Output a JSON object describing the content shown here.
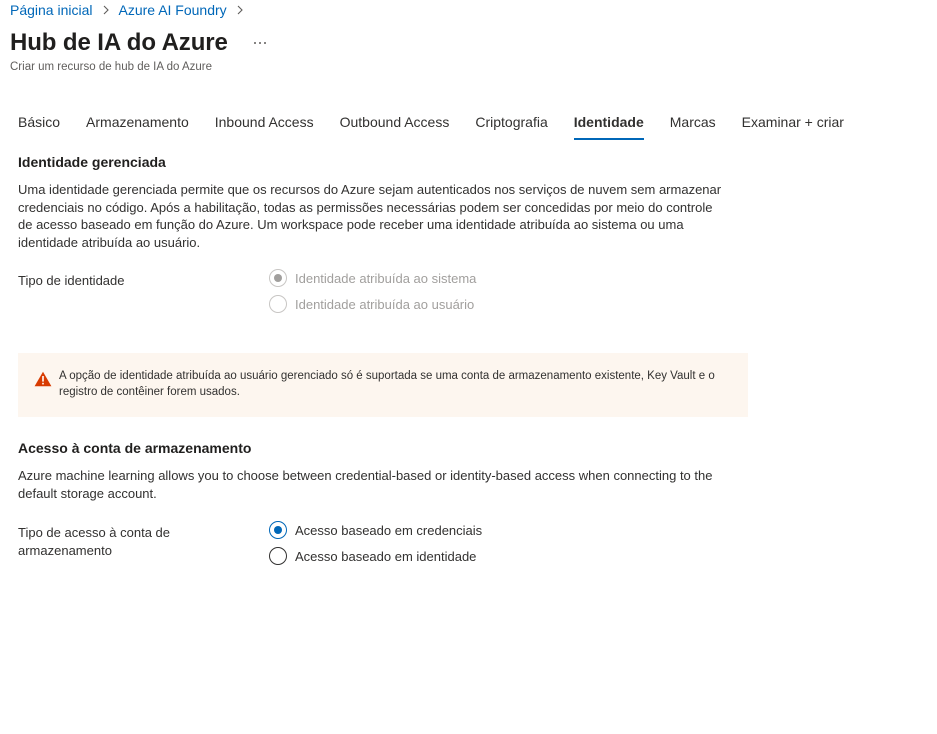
{
  "breadcrumb": {
    "items": [
      "Página inicial",
      "Azure AI Foundry"
    ]
  },
  "header": {
    "title": "Hub de IA do Azure",
    "more_label": "...",
    "subtitle": "Criar um recurso de hub de IA do Azure"
  },
  "tabs": [
    {
      "label": "Básico",
      "active": false
    },
    {
      "label": "Armazenamento",
      "active": false
    },
    {
      "label": "Inbound Access",
      "active": false
    },
    {
      "label": "Outbound Access",
      "active": false
    },
    {
      "label": "Criptografia",
      "active": false
    },
    {
      "label": "Identidade",
      "active": true
    },
    {
      "label": "Marcas",
      "active": false
    },
    {
      "label": "Examinar + criar",
      "active": false
    }
  ],
  "managed_identity": {
    "heading": "Identidade gerenciada",
    "description": "Uma identidade gerenciada permite que os recursos do Azure sejam autenticados nos serviços de nuvem sem armazenar credenciais no código. Após a habilitação, todas as permissões necessárias podem ser concedidas por meio do controle de acesso baseado em função do Azure. Um workspace pode receber uma identidade atribuída ao sistema ou uma identidade atribuída ao usuário.",
    "field_label": "Tipo de identidade",
    "options": [
      {
        "label": "Identidade atribuída ao sistema",
        "checked": true,
        "disabled": true
      },
      {
        "label": "Identidade atribuída ao usuário",
        "checked": false,
        "disabled": true
      }
    ]
  },
  "warning": {
    "icon": "warning-icon",
    "text": "A opção de identidade atribuída ao usuário gerenciado só é suportada se uma conta de armazenamento existente, Key Vault e o registro de contêiner forem usados."
  },
  "storage_access": {
    "heading": "Acesso à conta de armazenamento",
    "description": "Azure machine learning allows you to choose between credential-based or identity-based access when connecting to the default storage account.",
    "field_label": "Tipo de acesso à conta de armazenamento",
    "options": [
      {
        "label": "Acesso baseado em credenciais",
        "checked": true,
        "disabled": false
      },
      {
        "label": "Acesso baseado em identidade",
        "checked": false,
        "disabled": false
      }
    ]
  },
  "colors": {
    "accent": "#0067b8",
    "warning_bg": "#fdf6ef",
    "warning_icon": "#d83b01"
  }
}
